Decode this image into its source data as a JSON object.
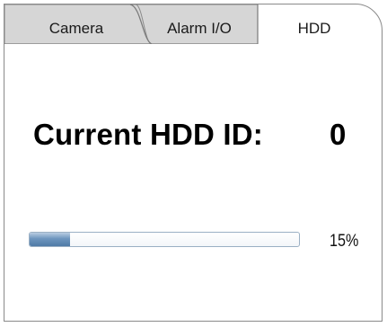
{
  "tabs": [
    {
      "label": "Camera",
      "active": false
    },
    {
      "label": "Alarm I/O",
      "active": false
    },
    {
      "label": "HDD",
      "active": true
    }
  ],
  "hdd": {
    "title": "Current HDD ID:",
    "id_value": "0",
    "progress_percent": 15,
    "progress_label": "15%"
  },
  "colors": {
    "inactive_tab": "#d6d6d6",
    "active_tab": "#ffffff",
    "border": "#8a8a8a",
    "progress_fill": "#4f7aa6"
  }
}
